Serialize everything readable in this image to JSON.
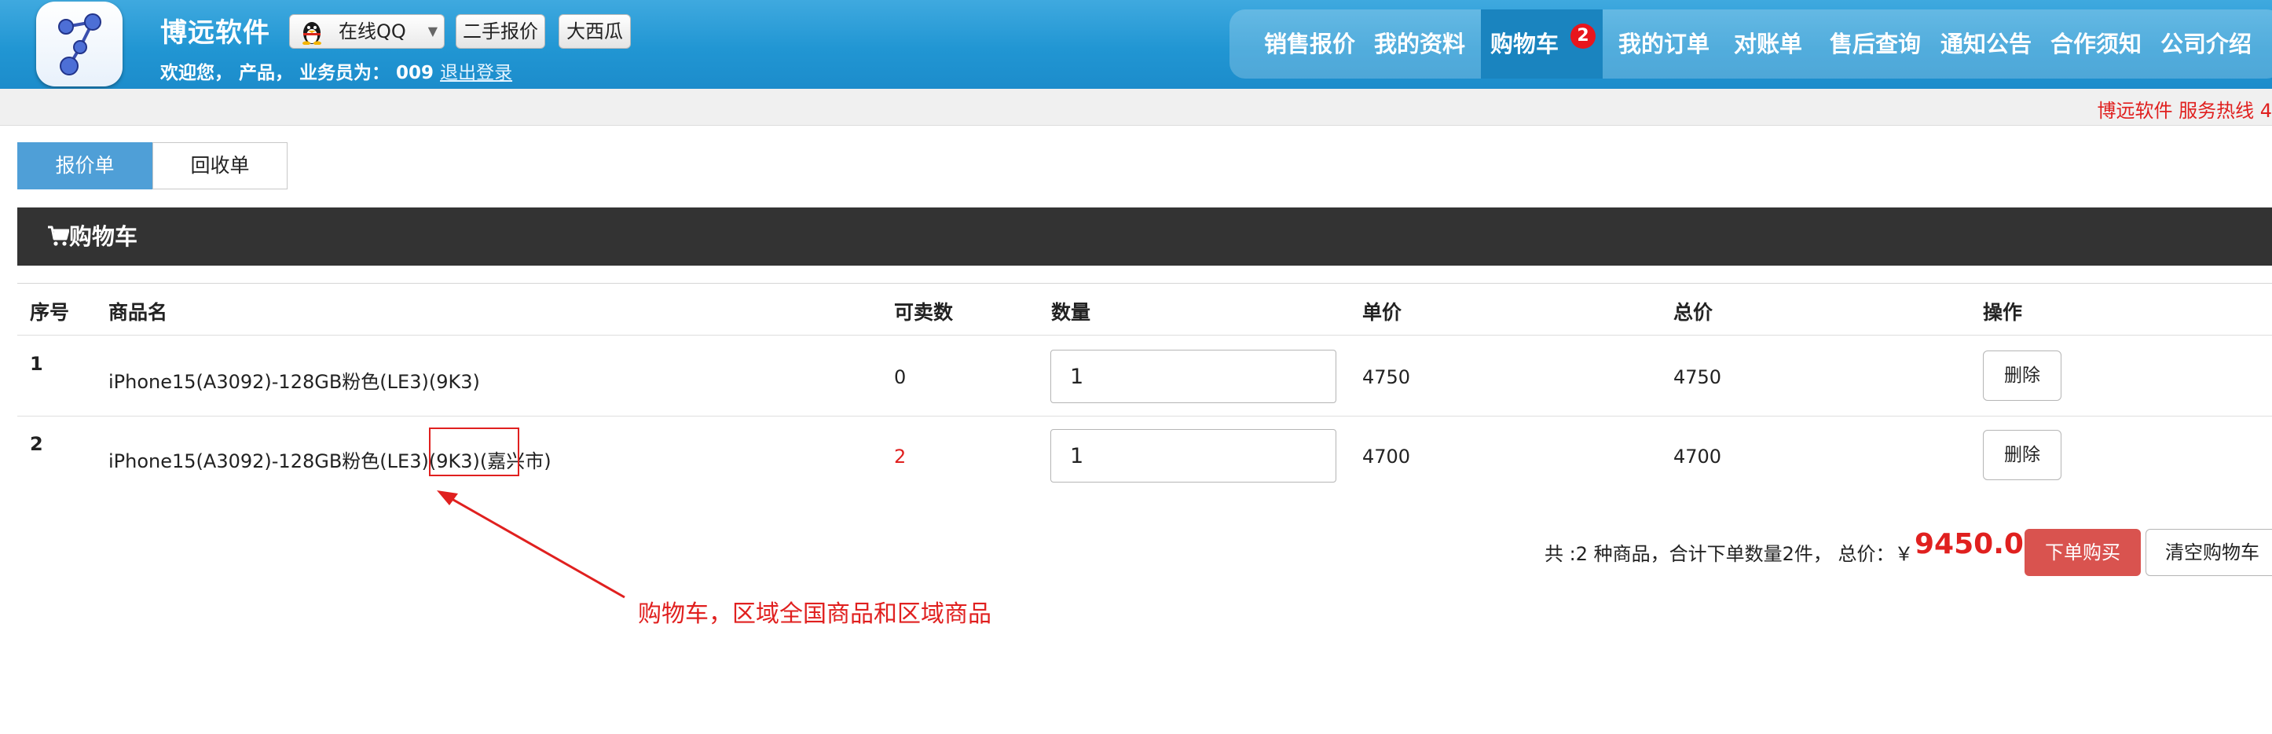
{
  "header": {
    "brand": "博远软件",
    "qq": {
      "label": "在线QQ"
    },
    "buttons": [
      "二手报价",
      "大西瓜"
    ],
    "welcome": {
      "prefix": "欢迎您，  产品，  业务员为：",
      "rep_code": "009",
      "logout": "退出登录"
    },
    "nav": [
      {
        "label": "销售报价"
      },
      {
        "label": "我的资料"
      },
      {
        "label": "购物车",
        "badge": "2",
        "active": true
      },
      {
        "label": "我的订单"
      },
      {
        "label": "对账单"
      },
      {
        "label": "售后查询"
      },
      {
        "label": "通知公告"
      },
      {
        "label": "合作须知"
      },
      {
        "label": "公司介绍"
      }
    ]
  },
  "hotline": "博远软件 服务热线 4",
  "tabs": [
    {
      "label": "报价单",
      "active": true
    },
    {
      "label": "回收单",
      "active": false
    }
  ],
  "panel": {
    "title": "购物车"
  },
  "table": {
    "headers": [
      "序号",
      "商品名",
      "可卖数",
      "数量",
      "单价",
      "总价",
      "操作"
    ],
    "rows": [
      {
        "index": "1",
        "name": "iPhone15(A3092)-128GB粉色(LE3)(9K3)",
        "available": "0",
        "qty": "1",
        "unit_price": "4750",
        "total": "4750",
        "action": "删除"
      },
      {
        "index": "2",
        "name": "iPhone15(A3092)-128GB粉色(LE3)(9K3)(嘉兴市)",
        "available": "2",
        "qty": "1",
        "unit_price": "4700",
        "total": "4700",
        "action": "删除"
      }
    ]
  },
  "summary": {
    "text": "共 :2 种商品，合计下单数量2件，  总价：￥",
    "total": "9450.00",
    "order_button": "下单购买",
    "clear_button": "清空购物车"
  },
  "annotation": {
    "text": "购物车，区域全国商品和区域商品"
  },
  "colors": {
    "header_blue": "#2196d3",
    "active_nav": "#1a84bf",
    "tab_active": "#4f9fd7",
    "panel_dark": "#333333",
    "price_red": "#e0201f",
    "order_button": "#d9534f"
  }
}
